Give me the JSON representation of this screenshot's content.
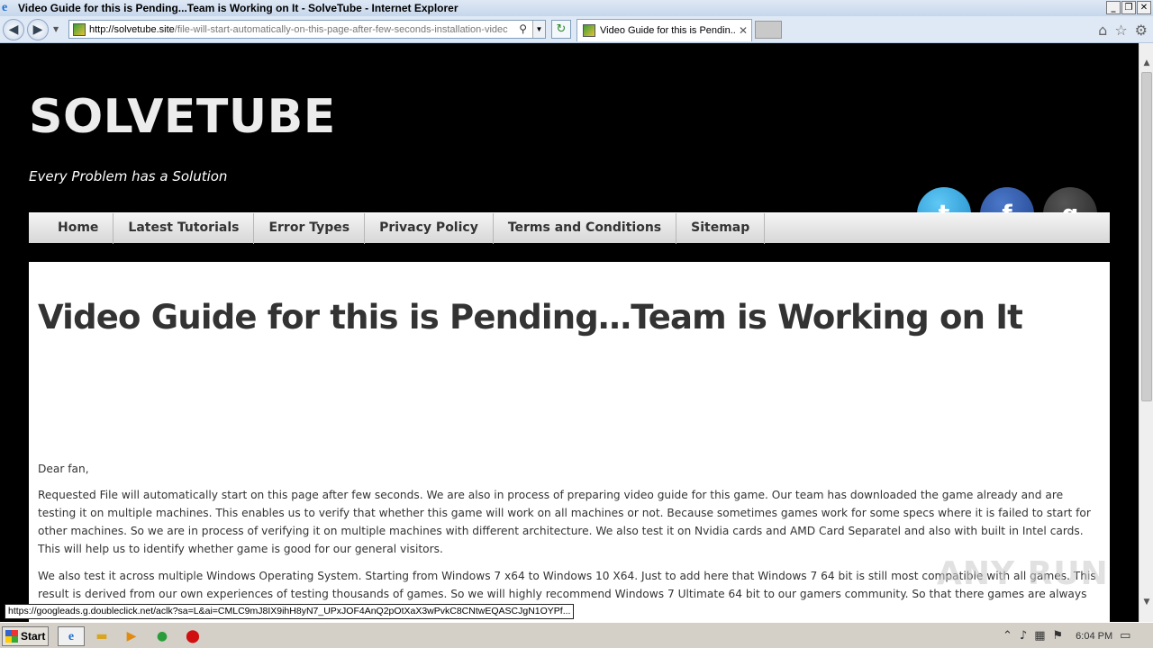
{
  "window": {
    "title": "Video Guide for this is Pending...Team is Working on It - SolveTube - Internet Explorer",
    "min": "_",
    "max": "❐",
    "close": "✕"
  },
  "nav": {
    "url_domain": "http://solvetube.site",
    "url_path": "/file-will-start-automatically-on-this-page-after-few-seconds-installation-videc",
    "tab_title": "Video Guide for this is Pendin...",
    "tab_close": "✕"
  },
  "site": {
    "title": "SOLVETUBE",
    "tagline": "Every Problem has a Solution",
    "social": {
      "twitter": "t",
      "facebook": "f",
      "gplus": "g"
    }
  },
  "menu": {
    "items": [
      {
        "label": "Home"
      },
      {
        "label": "Latest Tutorials"
      },
      {
        "label": "Error Types"
      },
      {
        "label": "Privacy Policy"
      },
      {
        "label": "Terms and Conditions"
      },
      {
        "label": "Sitemap"
      }
    ]
  },
  "post": {
    "title": "Video Guide for this is Pending…Team is Working on It",
    "paragraphs": [
      "Dear fan,",
      "Requested File will automatically start on this page after few seconds. We are also in process of preparing video guide for this game. Our team has downloaded the game already and are testing it on multiple machines. This enables us to verify that whether this game will work on all machines or not. Because sometimes games work for some specs where it is failed to start for other machines. So we are in process of verifying it on multiple machines with different architecture. We also test it on Nvidia cards and AMD Card Separatel and also with built in Intel cards. This will help us to identify whether game is good for our general visitors.",
      "We also test it across multiple Windows Operating System. Starting from Windows 7 x64 to Windows 10 X64. Just to add here that Windows 7 64 bit is still most compatible with all games. This result is derived from our own experiences of testing thousands of games. So we will highly recommend Windows 7 Ultimate 64 bit to our gamers community. So that there games are always error free. Please make sure you have installed latest updates fixes as well."
    ]
  },
  "status_url": "https://googleads.g.doubleclick.net/aclk?sa=L&ai=CMLC9mJ8IX9ihH8yN7_UPxJOF4AnQ2pOtXaX3wPvkC8CNtwEQASCJgN1OYPf...",
  "watermark": "ANY RUN",
  "taskbar": {
    "start": "Start",
    "clock": "6:04 PM"
  }
}
